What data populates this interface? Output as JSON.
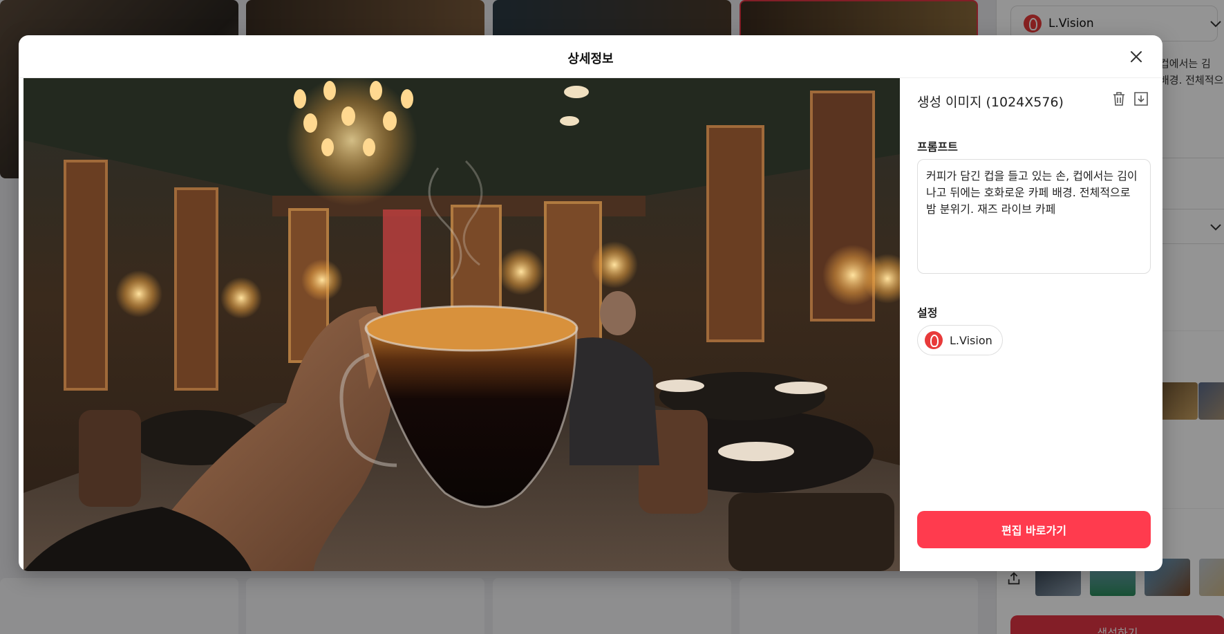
{
  "modal": {
    "title": "상세정보",
    "image_title": "생성 이미지 (1024X576)",
    "prompt_label": "프롬프트",
    "prompt_text": "커피가 담긴 컵을 들고 있는 손, 컵에서는 김이 나고 뒤에는 호화로운 카페 배경. 전체적으로 밤 분위기. 재즈 라이브 카페",
    "settings_label": "설정",
    "model_name": "L.Vision",
    "edit_button": "편집 바로가기",
    "icons": [
      "close-icon",
      "trash-icon",
      "download-icon",
      "lvision-logo-icon"
    ]
  },
  "background": {
    "sidebar_model": "L.Vision",
    "sidebar_prompt": "컵에서는 김\n배경. 전체적으",
    "generate_button": "생성하기"
  },
  "colors": {
    "accent": "#ff3b4e",
    "logo": "#e83a3a",
    "overlay": "rgba(0,0,0,0.42)"
  }
}
